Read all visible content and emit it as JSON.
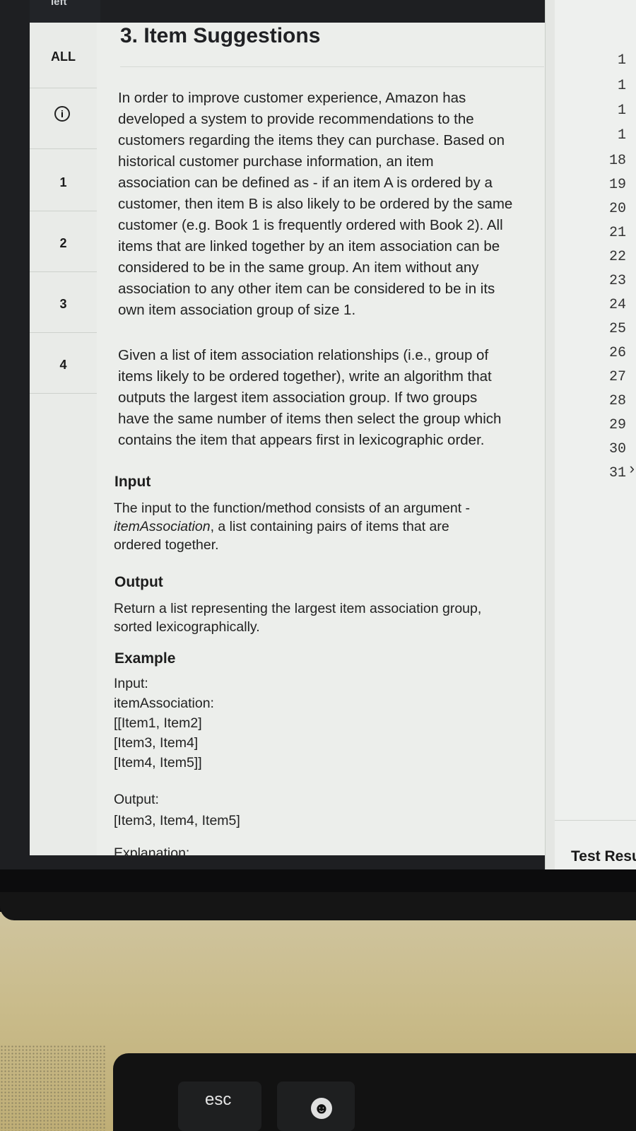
{
  "nav": {
    "top_tab": "left",
    "all_label": "ALL",
    "items": [
      "1",
      "2",
      "3",
      "4"
    ]
  },
  "problem": {
    "title": "3. Item Suggestions",
    "para1_lines": [
      "In order to improve customer experience, Amazon has",
      "developed a system to provide recommendations to the",
      "customers regarding the items they can purchase. Based on",
      "historical customer purchase information, an item",
      "association can be defined as - if an item A is ordered by a",
      "customer, then item B is also likely to be ordered by the same",
      "customer (e.g. Book 1 is frequently ordered with Book 2). All",
      "items that are linked together by an item association can be",
      "considered to be in the same group. An item without any",
      "association to any other item can be considered to be in its",
      "own item association group of size 1."
    ],
    "para2_lines": [
      "Given a list of item association relationships (i.e., group of",
      "items likely to be ordered together), write an algorithm that",
      "outputs the largest item association group. If two groups",
      "have the same number of items then select the group which",
      "contains the item that appears first in lexicographic order."
    ],
    "input_heading": "Input",
    "input_line1": "The input to the function/method consists of an argument -",
    "input_line2_em": "itemAssociation",
    "input_line2_rest": ", a list containing pairs of items that are",
    "input_line3": "ordered together.",
    "output_heading": "Output",
    "output_line1": "Return a list representing the largest item association group,",
    "output_line2": "sorted lexicographically.",
    "example_heading": "Example",
    "example_lines": [
      "Input:",
      "itemAssociation:",
      "[[Item1, Item2]",
      " [Item3, Item4]",
      " [Item4, Item5]]"
    ],
    "output_label": "Output:",
    "output_value": "[Item3, Item4, Item5]",
    "explanation_label": "Explanation:"
  },
  "editor": {
    "line_numbers": [
      "1",
      "1",
      "1",
      "1",
      "18",
      "19",
      "20",
      "21",
      "22",
      "23",
      "24",
      "25",
      "26",
      "27",
      "28",
      "29",
      "30",
      "31"
    ],
    "test_results_label": "Test Resu"
  },
  "keyboard": {
    "esc_label": "esc",
    "emoji_key": "☻"
  }
}
